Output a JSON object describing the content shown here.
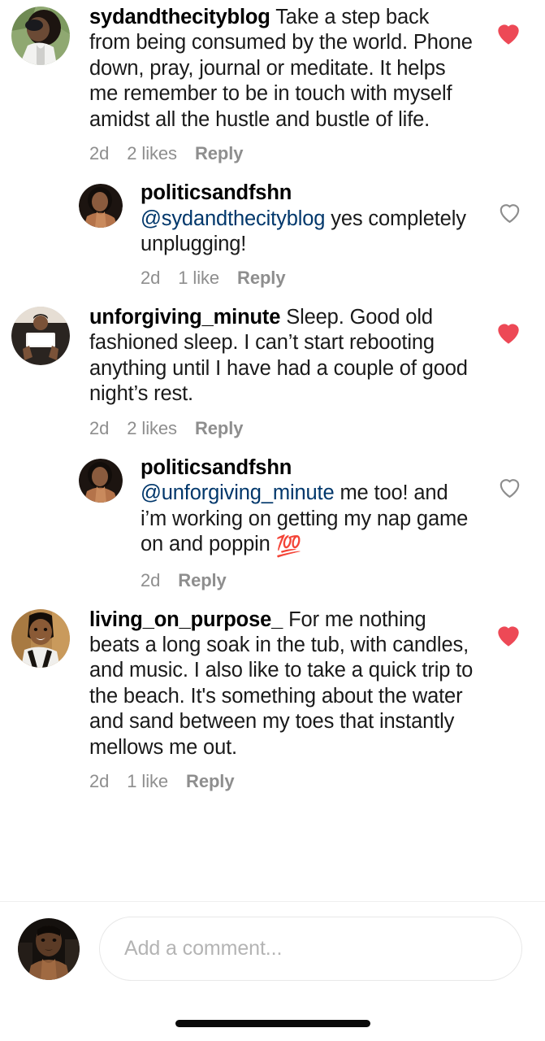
{
  "app": {
    "screen_name": "instagram-comments",
    "colors": {
      "liked_heart": "#ED4956",
      "unliked_heart": "#8e8e8e",
      "mention_link": "#00376b",
      "meta_text": "#8e8e8e",
      "body_text": "#1a1a1a",
      "divider": "#efefef",
      "placeholder": "#b4b4b4",
      "home_indicator": "#0a0a0a"
    }
  },
  "comments": [
    {
      "id": "c1",
      "type": "top-level",
      "username": "sydandthecityblog",
      "mention": "",
      "text": " Take a step back from being consumed by the world. Phone down, pray, journal or meditate. It helps me remember to be in touch with myself amidst all the hustle and bustle of life.",
      "emoji": "",
      "timestamp": "2d",
      "likes": "2 likes",
      "reply_label": "Reply",
      "liked": true,
      "like_icon": "heart-filled-icon",
      "avatar": "avatar-sydandthecityblog"
    },
    {
      "id": "c2",
      "type": "reply",
      "username": "politicsandfshn",
      "mention": "@sydandthecityblog",
      "text": " yes completely unplugging!",
      "emoji": "",
      "timestamp": "2d",
      "likes": "1 like",
      "reply_label": "Reply",
      "liked": false,
      "like_icon": "heart-outline-icon",
      "avatar": "avatar-politicsandfshn"
    },
    {
      "id": "c3",
      "type": "top-level",
      "username": "unforgiving_minute",
      "mention": "",
      "text": " Sleep. Good old fashioned sleep.  I can’t start rebooting anything until I have had a couple of good night’s rest.",
      "emoji": "",
      "timestamp": "2d",
      "likes": "2 likes",
      "reply_label": "Reply",
      "liked": true,
      "like_icon": "heart-filled-icon",
      "avatar": "avatar-unforgiving-minute"
    },
    {
      "id": "c4",
      "type": "reply",
      "username": "politicsandfshn",
      "mention": "@unforgiving_minute",
      "text": " me too! and i’m working on getting my nap game on and poppin ",
      "emoji": "💯",
      "timestamp": "2d",
      "likes": "",
      "reply_label": "Reply",
      "liked": false,
      "like_icon": "heart-outline-icon",
      "avatar": "avatar-politicsandfshn"
    },
    {
      "id": "c5",
      "type": "top-level",
      "username": "living_on_purpose_",
      "mention": "",
      "text": " For me nothing beats a long soak in the tub, with candles, and music. I also like to take a quick trip to the beach. It's something about the water and sand between my toes that instantly mellows me out.",
      "emoji": "",
      "timestamp": "2d",
      "likes": "1 like",
      "reply_label": "Reply",
      "liked": true,
      "like_icon": "heart-filled-icon",
      "avatar": "avatar-living-on-purpose"
    }
  ],
  "compose": {
    "placeholder": "Add a comment...",
    "avatar": "avatar-current-user"
  }
}
